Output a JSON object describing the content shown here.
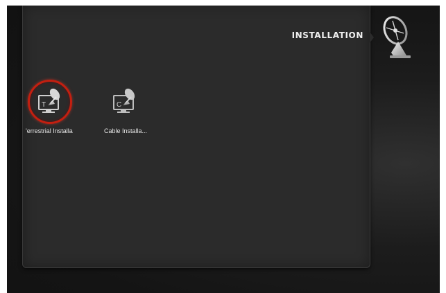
{
  "header": {
    "title": "INSTALLATION",
    "icon": "satellite-dish-icon"
  },
  "menu": {
    "items": [
      {
        "label": "'errestrial Installa",
        "badge": "T",
        "icon": "tv-satellite-icon",
        "selected": true
      },
      {
        "label": "Cable Installa...",
        "badge": "C",
        "icon": "tv-satellite-icon",
        "selected": false
      }
    ]
  },
  "colors": {
    "background": "#141414",
    "panel": "#2b2b2b",
    "selection_ring": "#c41f10",
    "text": "#f0f0f0"
  }
}
